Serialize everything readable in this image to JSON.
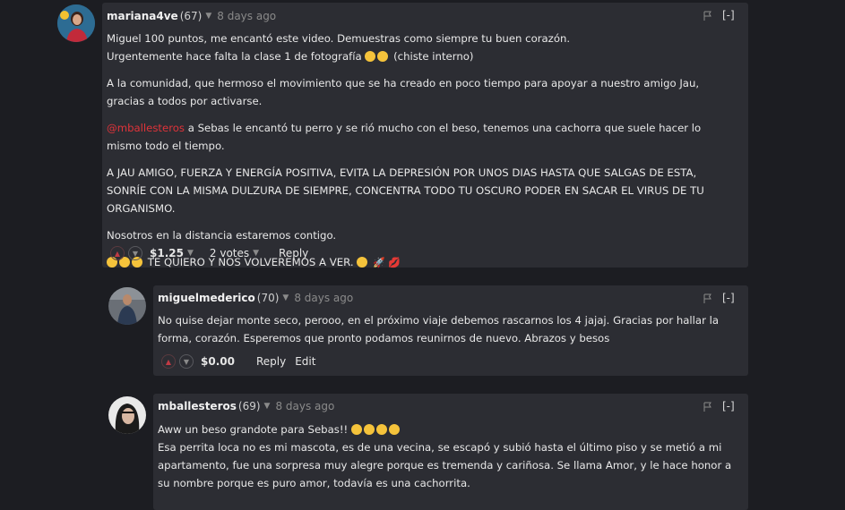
{
  "comments": [
    {
      "author": "mariana4ve",
      "reputation": "(67)",
      "time": "8 days ago",
      "collapse": "[-]",
      "p1l1": "Miguel 100 puntos, me encantó este video. Demuestras como siempre tu buen corazón.",
      "p1l2": "Urgentemente hace falta la clase 1 de fotografía",
      "p1l2b": "(chiste interno)",
      "p2": "A la comunidad, que hermoso el movimiento que se ha creado en poco tiempo para apoyar a nuestro amigo Jau, gracias a todos por activarse.",
      "mention": "@mballesteros",
      "p3": " a Sebas le encantó tu perro y se rió mucho con el beso, tenemos una cachorra que suele hacer lo mismo todo el tiempo.",
      "p4": "A JAU AMIGO, FUERZA Y ENERGÍA POSITIVA, EVITA LA DEPRESIÓN POR UNOS DIAS HASTA QUE SALGAS DE ESTA, SONRÍE CON LA MISMA DULZURA DE SIEMPRE, CONCENTRA TODO TU OSCURO PODER EN SACAR EL VIRUS DE TU ORGANISMO.",
      "p5": "Nosotros en la distancia estaremos contigo.",
      "p6": "TE QUIERO Y NOS VOLVEREMOS A VER.",
      "payout": "$1.25",
      "votes": "2 votes",
      "reply": "Reply"
    },
    {
      "author": "miguelmederico",
      "reputation": "(70)",
      "time": "8 days ago",
      "collapse": "[-]",
      "p1": "No quise dejar monte seco, perooo, en el próximo viaje debemos rascarnos los 4 jajaj. Gracias por hallar la forma, corazón. Esperemos que pronto podamos reunirnos de nuevo. Abrazos y besos",
      "payout": "$0.00",
      "reply": "Reply",
      "edit": "Edit"
    },
    {
      "author": "mballesteros",
      "reputation": "(69)",
      "time": "8 days ago",
      "collapse": "[-]",
      "p1": "Aww un beso grandote para Sebas!!",
      "p2": "Esa perrita loca no es mi mascota, es de una vecina, se escapó y subió hasta el último piso y se metió a mi apartamento, fue una sorpresa muy alegre porque es tremenda y cariñosa. Se llama Amor, y le hace honor a su nombre porque es puro amor, todavía es una cachorrita."
    }
  ]
}
